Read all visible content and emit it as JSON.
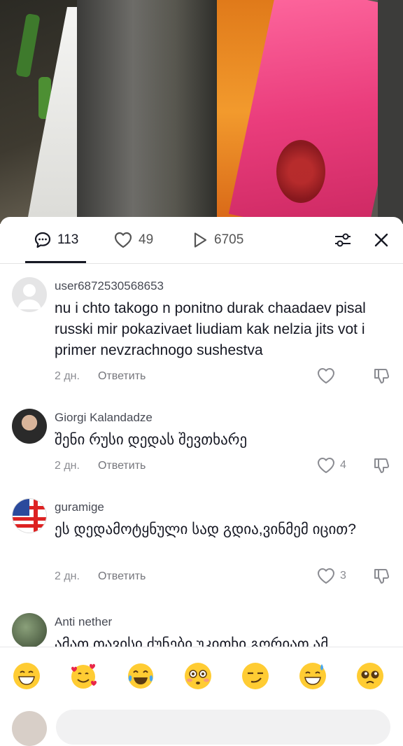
{
  "tabs": {
    "comments_count": "113",
    "likes_count": "49",
    "views_count": "6705"
  },
  "comments": [
    {
      "username": "user6872530568653",
      "text": "nu i chto takogo n ponitno durak chaadaev pisal russki mir pokazivaet liudiam kak nelzia jits vot i primer nevzrachnogo sushestva",
      "time": "2 дн.",
      "reply_label": "Ответить",
      "likes": ""
    },
    {
      "username": "Giorgi Kalandadze",
      "text": "შენი რუსი დედას შევთხარე",
      "time": "2 дн.",
      "reply_label": "Ответить",
      "likes": "4"
    },
    {
      "username": "guramige",
      "text": "ეს დედამოტყნული სად გდია,ვინმემ იცით?",
      "time": "2 дн.",
      "reply_label": "Ответить",
      "likes": "3"
    },
    {
      "username": "Anti nether",
      "text": "ამათ თავისი ძუნები უკითხი გორიათ ამ",
      "time": "",
      "reply_label": "",
      "likes": ""
    }
  ],
  "emojis": [
    "grin",
    "smiling-hearts",
    "tears-of-joy",
    "flushed",
    "smirk",
    "sweat-smile",
    "pleading"
  ],
  "colors": {
    "text": "#161823",
    "muted": "#8a8b91"
  }
}
